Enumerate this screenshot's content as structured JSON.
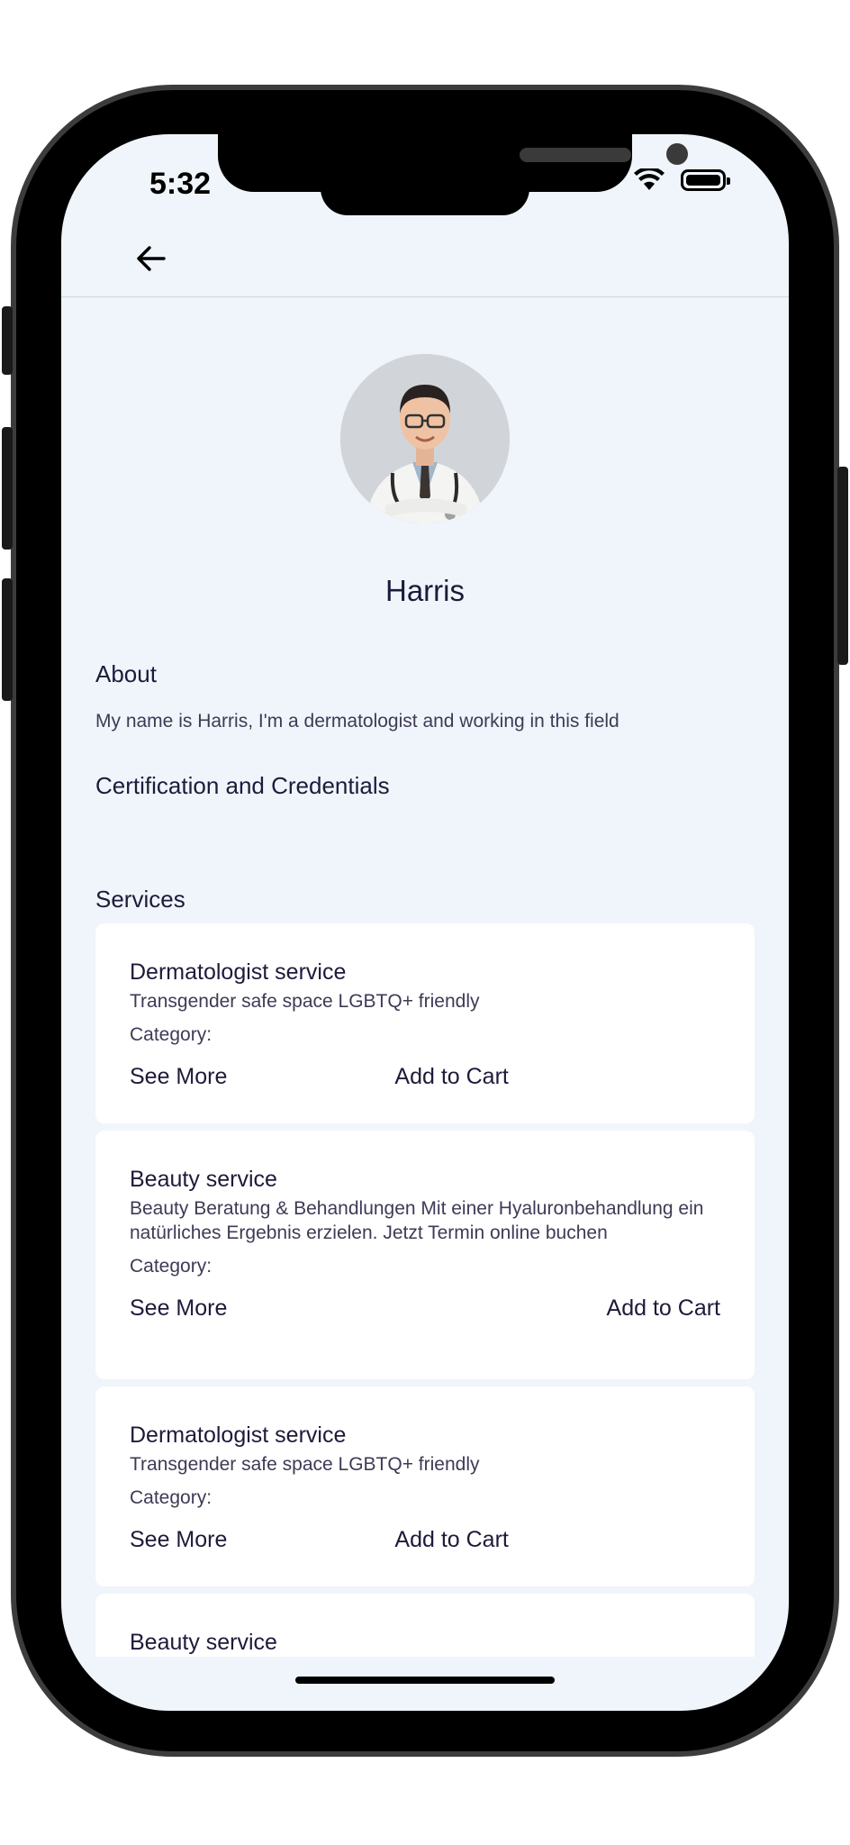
{
  "status_bar": {
    "time": "5:32"
  },
  "profile": {
    "name": "Harris",
    "about_title": "About",
    "about_text": "My name is Harris, I'm a dermatologist and working in this field",
    "cert_title": "Certification and Credentials",
    "services_title": "Services"
  },
  "services": [
    {
      "title": "Dermatologist service",
      "description": "Transgender safe space LGBTQ+ friendly",
      "category_label": "Category:",
      "see_more": "See More",
      "add_to_cart": "Add to Cart"
    },
    {
      "title": "Beauty service",
      "description": "Beauty Beratung & Behandlungen Mit einer Hyaluronbehandlung ein natürliches Ergebnis erzielen. Jetzt Termin online buchen",
      "category_label": "Category:",
      "see_more": "See More",
      "add_to_cart": "Add to Cart"
    },
    {
      "title": "Dermatologist service",
      "description": "Transgender safe space LGBTQ+ friendly",
      "category_label": "Category:",
      "see_more": "See More",
      "add_to_cart": "Add to Cart"
    },
    {
      "title": "Beauty service"
    }
  ],
  "icons": {
    "back": "arrow-left-icon",
    "signal": "signal-icon",
    "wifi": "wifi-icon",
    "battery": "battery-icon"
  }
}
